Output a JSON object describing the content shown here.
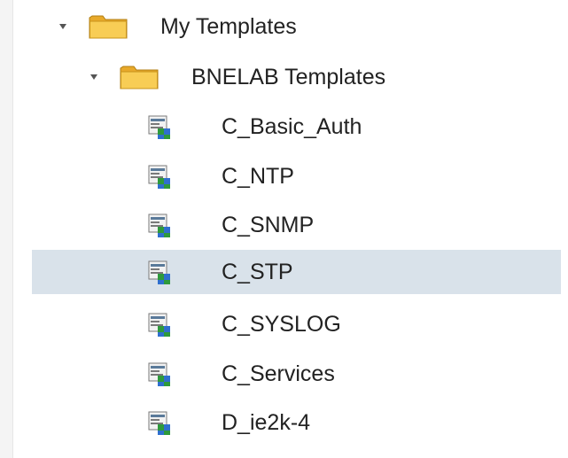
{
  "tree": {
    "root": {
      "label": "My Templates",
      "icon": "folder-icon",
      "expanded": true,
      "children": [
        {
          "label": "BNELAB Templates",
          "icon": "folder-icon",
          "expanded": true,
          "children": [
            {
              "label": "C_Basic_Auth",
              "icon": "template-icon"
            },
            {
              "label": "C_NTP",
              "icon": "template-icon"
            },
            {
              "label": "C_SNMP",
              "icon": "template-icon"
            },
            {
              "label": "C_STP",
              "icon": "template-icon",
              "selected": true
            },
            {
              "label": "C_SYSLOG",
              "icon": "template-icon"
            },
            {
              "label": "C_Services",
              "icon": "template-icon"
            },
            {
              "label": "D_ie2k-4",
              "icon": "template-icon"
            }
          ]
        }
      ]
    }
  },
  "colors": {
    "selection": "#d9e2ea",
    "folder": "#f7c948",
    "text": "#222222"
  }
}
